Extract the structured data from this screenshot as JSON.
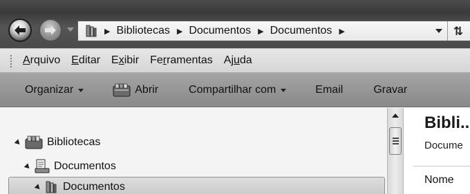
{
  "navigation": {
    "back_icon": "back-arrow-icon",
    "forward_icon": "forward-arrow-icon",
    "recent_pages_icon": "chevron-down-icon"
  },
  "address_bar": {
    "icon": "library-icon",
    "breadcrumbs": [
      "Bibliotecas",
      "Documentos",
      "Documentos"
    ],
    "dropdown_icon": "chevron-down-icon",
    "refresh_icon": "refresh-icon"
  },
  "menu": {
    "items": [
      {
        "label": "Arquivo",
        "accel": "A",
        "pre": "",
        "post": "rquivo"
      },
      {
        "label": "Editar",
        "accel": "E",
        "pre": "",
        "post": "ditar"
      },
      {
        "label": "Exibir",
        "accel": "x",
        "pre": "E",
        "post": "ibir"
      },
      {
        "label": "Ferramentas",
        "accel": "r",
        "pre": "Fe",
        "post": "ramentas"
      },
      {
        "label": "Ajuda",
        "accel": "u",
        "pre": "Aj",
        "post": "da"
      }
    ]
  },
  "toolbar": {
    "organize": "Organizar",
    "open": "Abrir",
    "share": "Compartilhar com",
    "email": "Email",
    "burn": "Gravar"
  },
  "nav_pane": {
    "libraries": "Bibliotecas",
    "documents": "Documentos",
    "documents_child": "Documentos",
    "selected": "Documentos"
  },
  "content": {
    "title": "Bibli...",
    "subtitle": "Docume",
    "column_name": "Nome"
  },
  "colors": {
    "address_bar": "#3f3f3f",
    "menu_bar": "#dcdcdc",
    "toolbar": "#959595",
    "nav_pane": "#f4f4f4"
  }
}
